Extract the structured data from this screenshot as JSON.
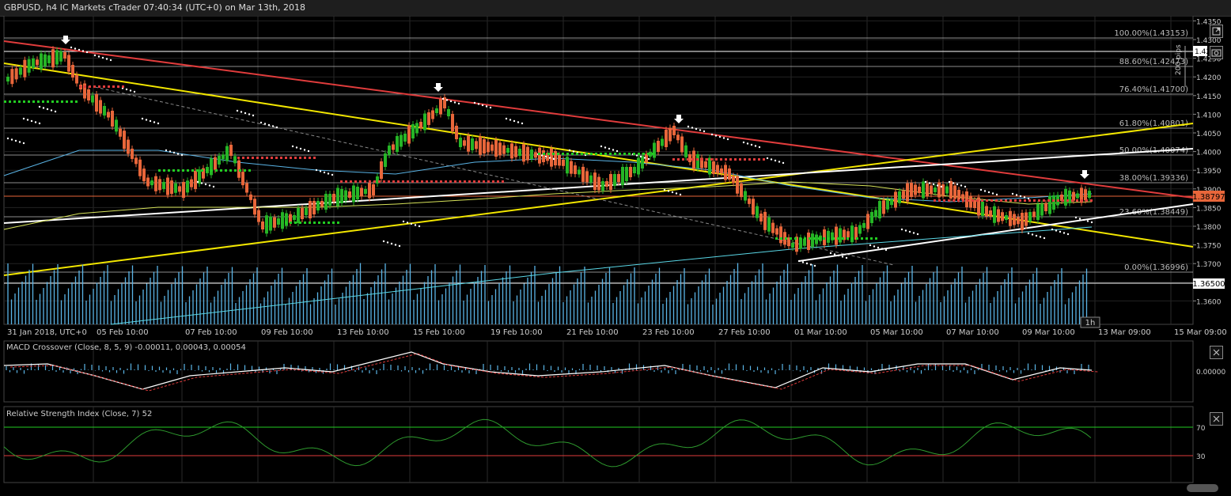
{
  "window": {
    "title": "GBPUSD, h4 IC Markets cTrader 07:40:34 (UTC+0) on Mar 13th, 2018"
  },
  "main_chart": {
    "price_ticks": [
      "1.4350",
      "1.4300",
      "1.4250",
      "1.4200",
      "1.4150",
      "1.4100",
      "1.4050",
      "1.4000",
      "1.3950",
      "1.3900",
      "1.3850",
      "1.3800",
      "1.3750",
      "1.3700",
      "1.3650",
      "1.3600"
    ],
    "time_ticks": [
      "31 Jan 2018, UTC+0",
      "05 Feb 10:00",
      "07 Feb 10:00",
      "09 Feb 10:00",
      "13 Feb 10:00",
      "15 Feb 10:00",
      "19 Feb 10:00",
      "21 Feb 10:00",
      "23 Feb 10:00",
      "27 Feb 10:00",
      "01 Mar 10:00",
      "05 Mar 10:00",
      "07 Mar 10:00",
      "09 Mar 10:00",
      "13 Mar 09:00",
      "15 Mar 09:00"
    ],
    "fibonacci_levels": [
      {
        "label": "100.00%(1.43153)"
      },
      {
        "label": "88.60%(1.42473)"
      },
      {
        "label": "76.40%(1.41700)"
      },
      {
        "label": "61.80%(1.40801)"
      },
      {
        "label": "50.00%(1.40074)"
      },
      {
        "label": "38.00%(1.39336)"
      },
      {
        "label": "23.60%(1.38449)"
      },
      {
        "label": "0.00%(1.36996)"
      }
    ],
    "current_price": "1.38797",
    "volume_marker": "1.36500",
    "upper_marker": "1.42",
    "pips_label": "200 pips",
    "timeframe_badge": "1h",
    "colors": {
      "bull": "#26b526",
      "bear": "#e8663a",
      "red_line": "#e03c3c",
      "yellow_line": "#f2e600",
      "white_line": "#ffffff",
      "volume": "#5ab4e6"
    }
  },
  "macd_panel": {
    "title": "MACD Crossover (Close, 8, 5, 9) -0.00011, 0.00043, 0.00054",
    "zero_label": "0.00000"
  },
  "rsi_panel": {
    "title": "Relative Strength Index (Close, 7) 52",
    "upper_level": "70",
    "lower_level": "30"
  }
}
